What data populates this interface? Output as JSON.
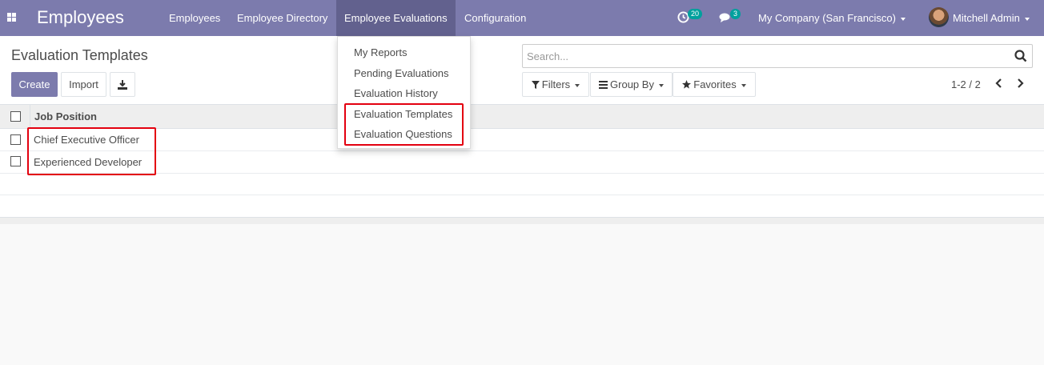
{
  "navbar": {
    "app_name": "Employees",
    "menus": [
      "Employees",
      "Employee Directory",
      "Employee Evaluations",
      "Configuration"
    ],
    "activities_count": "20",
    "messages_count": "3",
    "company": "My Company (San Francisco)",
    "user": "Mitchell Admin"
  },
  "control_panel": {
    "title": "Evaluation Templates",
    "create_label": "Create",
    "import_label": "Import",
    "search_placeholder": "Search...",
    "filters_label": "Filters",
    "group_by_label": "Group By",
    "favorites_label": "Favorites",
    "pager": "1-2 / 2"
  },
  "list": {
    "header": "Job Position",
    "rows": [
      "Chief Executive Officer",
      "Experienced Developer"
    ]
  },
  "dropdown": {
    "items": [
      "My Reports",
      "Pending Evaluations",
      "Evaluation History",
      "Evaluation Templates",
      "Evaluation Questions"
    ]
  },
  "colors": {
    "navbar": "#7c7bad",
    "navbar_active": "#62618e",
    "primary": "#7c7bad",
    "badge": "#00a09d",
    "highlight": "#e3000f"
  }
}
